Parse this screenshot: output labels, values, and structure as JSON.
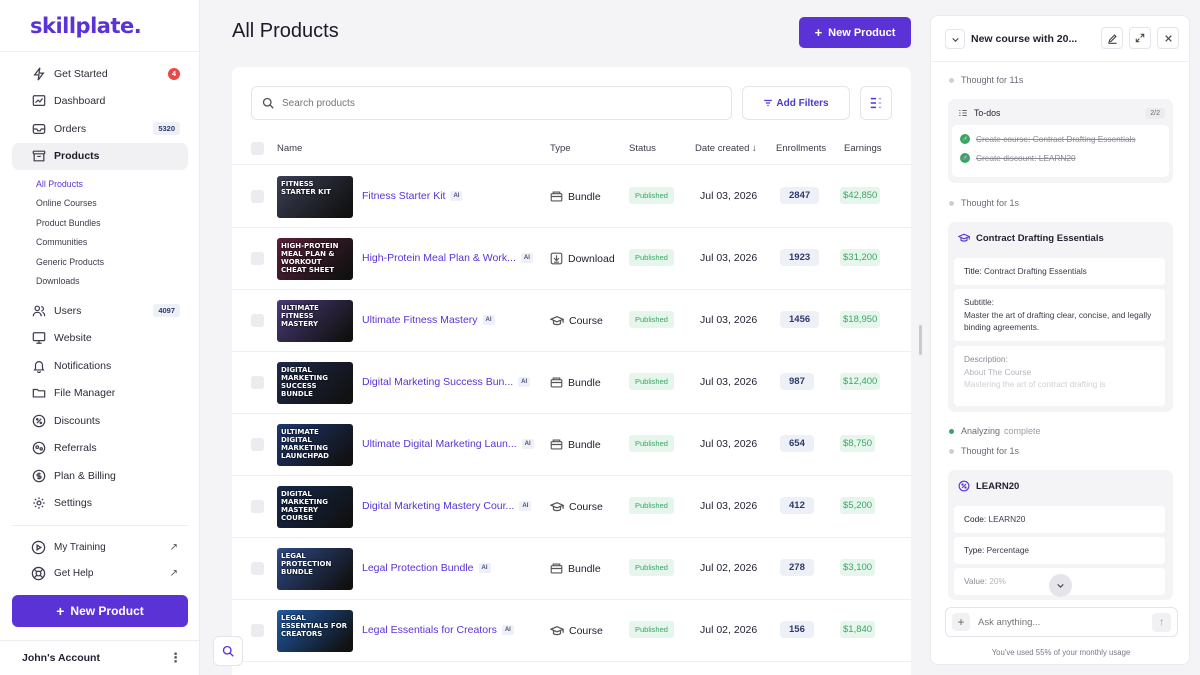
{
  "brand": {
    "logo_text": "skillplate.",
    "accent": "#5b32d6"
  },
  "sidebar": {
    "items": [
      {
        "label": "Get Started",
        "icon": "lightning-icon",
        "badge": "4"
      },
      {
        "label": "Dashboard",
        "icon": "chart-icon"
      },
      {
        "label": "Orders",
        "icon": "inbox-icon",
        "badge": "5320"
      },
      {
        "label": "Products",
        "icon": "box-icon"
      }
    ],
    "subitems": [
      "All Products",
      "Online Courses",
      "Product Bundles",
      "Communities",
      "Generic Products",
      "Downloads"
    ],
    "items2": [
      {
        "label": "Users",
        "icon": "users-icon",
        "badge": "4097"
      },
      {
        "label": "Website",
        "icon": "monitor-icon"
      },
      {
        "label": "Notifications",
        "icon": "bell-icon"
      },
      {
        "label": "File Manager",
        "icon": "folder-icon"
      },
      {
        "label": "Discounts",
        "icon": "discount-icon"
      },
      {
        "label": "Referrals",
        "icon": "referral-icon"
      },
      {
        "label": "Plan & Billing",
        "icon": "billing-icon"
      },
      {
        "label": "Settings",
        "icon": "gear-icon"
      }
    ],
    "external": [
      {
        "label": "My Training",
        "icon": "play-icon"
      },
      {
        "label": "Get Help",
        "icon": "help-icon"
      }
    ],
    "new_product_label": "New Product",
    "account_label": "John's Account"
  },
  "main": {
    "title": "All Products",
    "new_product_label": "New Product",
    "search_placeholder": "Search products",
    "add_filters_label": "Add Filters",
    "columns": {
      "name": "Name",
      "type": "Type",
      "status": "Status",
      "date": "Date created",
      "enrollments": "Enrollments",
      "earnings": "Earnings"
    },
    "products": [
      {
        "name": "Fitness Starter Kit",
        "ai": "AI",
        "type": "Bundle",
        "status": "Published",
        "date": "Jul 03, 2026",
        "enrollments": "2847",
        "earnings": "$42,850",
        "thumb_text": "FITNESS STARTER KIT",
        "thumb_bg": "#3b3f55"
      },
      {
        "name": "High-Protein Meal Plan & Work...",
        "ai": "AI",
        "type": "Download",
        "status": "Published",
        "date": "Jul 03, 2026",
        "enrollments": "1923",
        "earnings": "$31,200",
        "thumb_text": "HIGH-PROTEIN MEAL PLAN & WORKOUT CHEAT SHEET",
        "thumb_bg": "#5a1f3a"
      },
      {
        "name": "Ultimate Fitness Mastery",
        "ai": "AI",
        "type": "Course",
        "status": "Published",
        "date": "Jul 03, 2026",
        "enrollments": "1456",
        "earnings": "$18,950",
        "thumb_text": "ULTIMATE FITNESS MASTERY",
        "thumb_bg": "#4b3a78"
      },
      {
        "name": "Digital Marketing Success Bun...",
        "ai": "AI",
        "type": "Bundle",
        "status": "Published",
        "date": "Jul 03, 2026",
        "enrollments": "987",
        "earnings": "$12,400",
        "thumb_text": "DIGITAL MARKETING SUCCESS BUNDLE",
        "thumb_bg": "#1d2a4a"
      },
      {
        "name": "Ultimate Digital Marketing Laun...",
        "ai": "AI",
        "type": "Bundle",
        "status": "Published",
        "date": "Jul 03, 2026",
        "enrollments": "654",
        "earnings": "$8,750",
        "thumb_text": "ULTIMATE DIGITAL MARKETING LAUNCHPAD",
        "thumb_bg": "#1e3770"
      },
      {
        "name": "Digital Marketing Mastery Cour...",
        "ai": "AI",
        "type": "Course",
        "status": "Published",
        "date": "Jul 03, 2026",
        "enrollments": "412",
        "earnings": "$5,200",
        "thumb_text": "DIGITAL MARKETING MASTERY COURSE",
        "thumb_bg": "#15294f"
      },
      {
        "name": "Legal Protection Bundle",
        "ai": "AI",
        "type": "Bundle",
        "status": "Published",
        "date": "Jul 02, 2026",
        "enrollments": "278",
        "earnings": "$3,100",
        "thumb_text": "LEGAL PROTECTION BUNDLE",
        "thumb_bg": "#2e4a8a"
      },
      {
        "name": "Legal Essentials for Creators",
        "ai": "AI",
        "type": "Course",
        "status": "Published",
        "date": "Jul 02, 2026",
        "enrollments": "156",
        "earnings": "$1,840",
        "thumb_text": "LEGAL ESSENTIALS FOR CREATORS",
        "thumb_bg": "#1f5aa8"
      }
    ]
  },
  "panel": {
    "title": "New course with 20...",
    "thought1": "Thought for 11s",
    "todos_label": "To-dos",
    "todos_count": "2/2",
    "todos": [
      "Create course: Contract Drafting Essentials",
      "Create discount: LEARN20"
    ],
    "thought2": "Thought for 1s",
    "course_title": "Contract Drafting Essentials",
    "course_fields": {
      "title_label": "Title:",
      "title_value": "Contract Drafting Essentials",
      "subtitle_label": "Subtitle:",
      "subtitle_value": "Master the art of drafting clear, concise, and legally binding agreements.",
      "description_label": "Description:",
      "description_value": "About The Course",
      "description_more": "Mastering the art of contract drafting is"
    },
    "analyzing": "Analyzing",
    "analyzing_status": "complete",
    "thought3": "Thought for 1s",
    "discount_title": "LEARN20",
    "discount_fields": {
      "code_label": "Code:",
      "code_value": "LEARN20",
      "type_label": "Type:",
      "type_value": "Percentage",
      "value_label": "Value:",
      "value_value": "20%"
    },
    "ask_placeholder": "Ask anything...",
    "usage": "You've used 55% of your monthly usage"
  }
}
